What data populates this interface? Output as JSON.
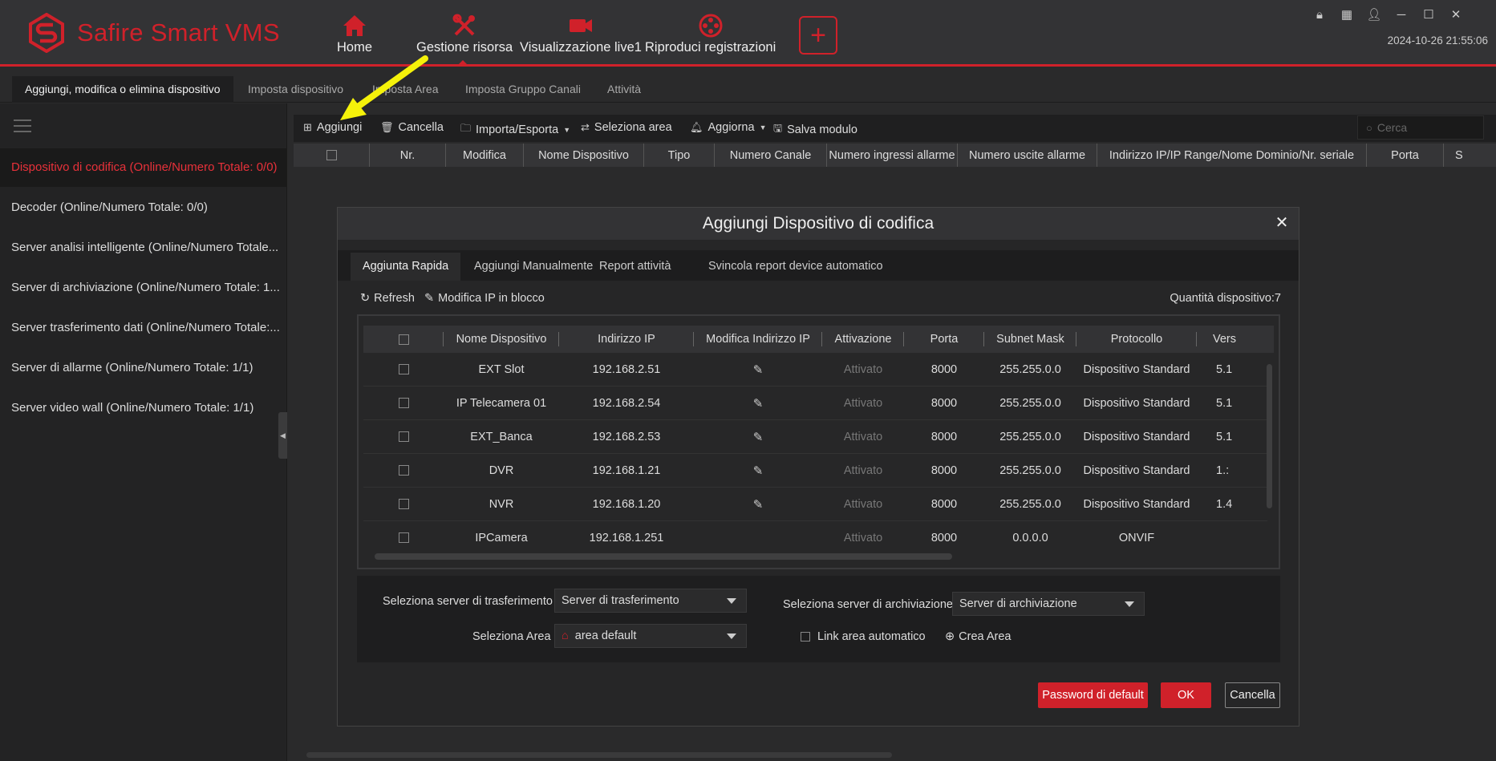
{
  "app": {
    "title": "Safire Smart VMS",
    "brand_color": "#d0212a",
    "datetime": "2024-10-26 21:55:06"
  },
  "nav": {
    "items": [
      {
        "label": "Home",
        "icon": "home-icon"
      },
      {
        "label": "Gestione risorsa",
        "icon": "tools-icon",
        "active": true
      },
      {
        "label": "Visualizzazione live1",
        "icon": "camera-icon"
      },
      {
        "label": "Riproduci registrazioni",
        "icon": "film-reel-icon"
      }
    ],
    "add_icon": "plus-icon"
  },
  "window_controls": [
    "lock-icon",
    "grid-icon",
    "user-icon",
    "minimize-icon",
    "maximize-icon",
    "close-icon"
  ],
  "subtabs": [
    {
      "label": "Aggiungi, modifica o elimina dispositivo",
      "active": true
    },
    {
      "label": "Imposta dispositivo"
    },
    {
      "label": "Imposta Area"
    },
    {
      "label": "Imposta Gruppo Canali"
    },
    {
      "label": "Attività"
    }
  ],
  "sidebar": {
    "items": [
      {
        "label": "Dispositivo di codifica (Online/Numero Totale: 0/0)",
        "active": true
      },
      {
        "label": "Decoder (Online/Numero Totale: 0/0)"
      },
      {
        "label": "Server analisi intelligente (Online/Numero Totale..."
      },
      {
        "label": "Server di archiviazione (Online/Numero Totale: 1..."
      },
      {
        "label": "Server trasferimento dati (Online/Numero Totale:..."
      },
      {
        "label": "Server di allarme (Online/Numero Totale: 1/1)"
      },
      {
        "label": "Server video wall (Online/Numero Totale: 1/1)"
      }
    ]
  },
  "toolbar": {
    "add": "Aggiungi",
    "delete": "Cancella",
    "import_export": "Importa/Esporta",
    "select_area": "Seleziona area",
    "update": "Aggiorna",
    "save_module": "Salva modulo",
    "search_placeholder": "Cerca"
  },
  "main_table": {
    "columns": [
      "Nr.",
      "Modifica",
      "Nome Dispositivo",
      "Tipo",
      "Numero Canale",
      "Numero ingressi allarme",
      "Numero uscite allarme",
      "Indirizzo IP/IP Range/Nome Dominio/Nr. seriale",
      "Porta",
      "S"
    ]
  },
  "dialog": {
    "title": "Aggiungi Dispositivo di codifica",
    "tabs": [
      "Aggiunta Rapida",
      "Aggiungi Manualmente",
      "Report attività",
      "Svincola report device automatico"
    ],
    "refresh": "Refresh",
    "bulk_edit_ip": "Modifica IP in blocco",
    "quantity": "Quantità dispositivo:7",
    "columns": [
      "Nome Dispositivo",
      "Indirizzo IP",
      "Modifica Indirizzo IP",
      "Attivazione",
      "Porta",
      "Subnet Mask",
      "Protocollo",
      "Vers"
    ],
    "rows": [
      {
        "name": "EXT Slot",
        "ip": "192.168.2.51",
        "edit": true,
        "activation": "Attivato",
        "port": "8000",
        "mask": "255.255.0.0",
        "protocol": "Dispositivo Standard",
        "version": "5.1"
      },
      {
        "name": "IP Telecamera 01",
        "ip": "192.168.2.54",
        "edit": true,
        "activation": "Attivato",
        "port": "8000",
        "mask": "255.255.0.0",
        "protocol": "Dispositivo Standard",
        "version": "5.1"
      },
      {
        "name": "EXT_Banca",
        "ip": "192.168.2.53",
        "edit": true,
        "activation": "Attivato",
        "port": "8000",
        "mask": "255.255.0.0",
        "protocol": "Dispositivo Standard",
        "version": "5.1"
      },
      {
        "name": "DVR",
        "ip": "192.168.1.21",
        "edit": true,
        "activation": "Attivato",
        "port": "8000",
        "mask": "255.255.0.0",
        "protocol": "Dispositivo Standard",
        "version": "1.:"
      },
      {
        "name": "NVR",
        "ip": "192.168.1.20",
        "edit": true,
        "activation": "Attivato",
        "port": "8000",
        "mask": "255.255.0.0",
        "protocol": "Dispositivo Standard",
        "version": "1.4"
      },
      {
        "name": "IPCamera",
        "ip": "192.168.1.251",
        "edit": false,
        "activation": "Attivato",
        "port": "8000",
        "mask": "0.0.0.0",
        "protocol": "ONVIF",
        "version": ""
      }
    ],
    "form": {
      "transfer_label": "Seleziona server di trasferimento",
      "transfer_value": "Server di trasferimento",
      "archive_label": "Seleziona server di archiviazione",
      "archive_value": "Server di archiviazione",
      "area_label": "Seleziona Area",
      "area_value": "area default",
      "link_area": "Link area automatico",
      "create_area": "Crea Area"
    },
    "buttons": {
      "default_password": "Password di default",
      "ok": "OK",
      "cancel": "Cancella"
    }
  },
  "annotation": {
    "arrow_color": "#f5f20a"
  }
}
